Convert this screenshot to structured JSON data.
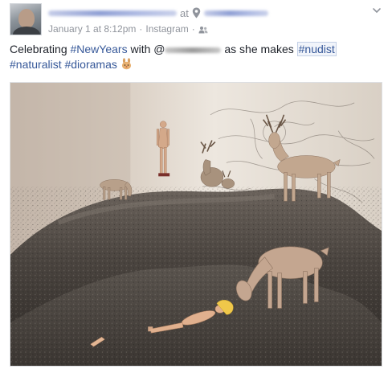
{
  "post": {
    "at_label": "at",
    "timestamp": "January 1 at 8:12pm",
    "separator": "·",
    "source": "Instagram",
    "separator2": "·",
    "icons": {
      "location": "location-pin-icon",
      "audience": "friends-icon",
      "options": "chevron-down-icon"
    },
    "text": {
      "part1": "Celebrating ",
      "tag1": "#NewYears",
      "part2": " with @",
      "part3": " as she makes ",
      "tag2": "#nudist",
      "tag3": "#naturalist",
      "tag4": "#dioramas",
      "emoji": "bunny-emoji"
    },
    "photo": {
      "subject": "diorama-photo"
    }
  },
  "colors": {
    "link": "#365899",
    "meta": "#90949c",
    "body_text": "#1d2129",
    "rock": "#3f3a36",
    "wall": "#d8cfc4"
  }
}
